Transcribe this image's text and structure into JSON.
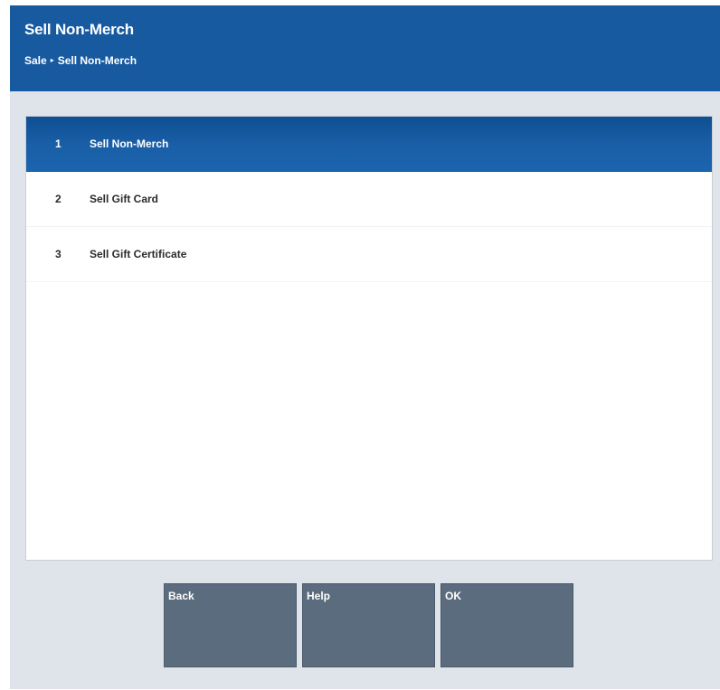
{
  "header": {
    "title": "Sell Non-Merch",
    "breadcrumb": {
      "parent": "Sale",
      "separator": "▸",
      "current": "Sell Non-Merch"
    }
  },
  "menu": {
    "items": [
      {
        "number": "1",
        "label": "Sell Non-Merch",
        "selected": true
      },
      {
        "number": "2",
        "label": "Sell Gift Card",
        "selected": false
      },
      {
        "number": "3",
        "label": "Sell Gift Certificate",
        "selected": false
      }
    ]
  },
  "buttons": {
    "back_label": "Back",
    "help_label": "Help",
    "ok_label": "OK"
  },
  "colors": {
    "header_bg": "#175aa0",
    "selected_row": "#1a5fa8",
    "button_bg": "#5a6c7d",
    "window_bg": "#dfe4ea"
  }
}
